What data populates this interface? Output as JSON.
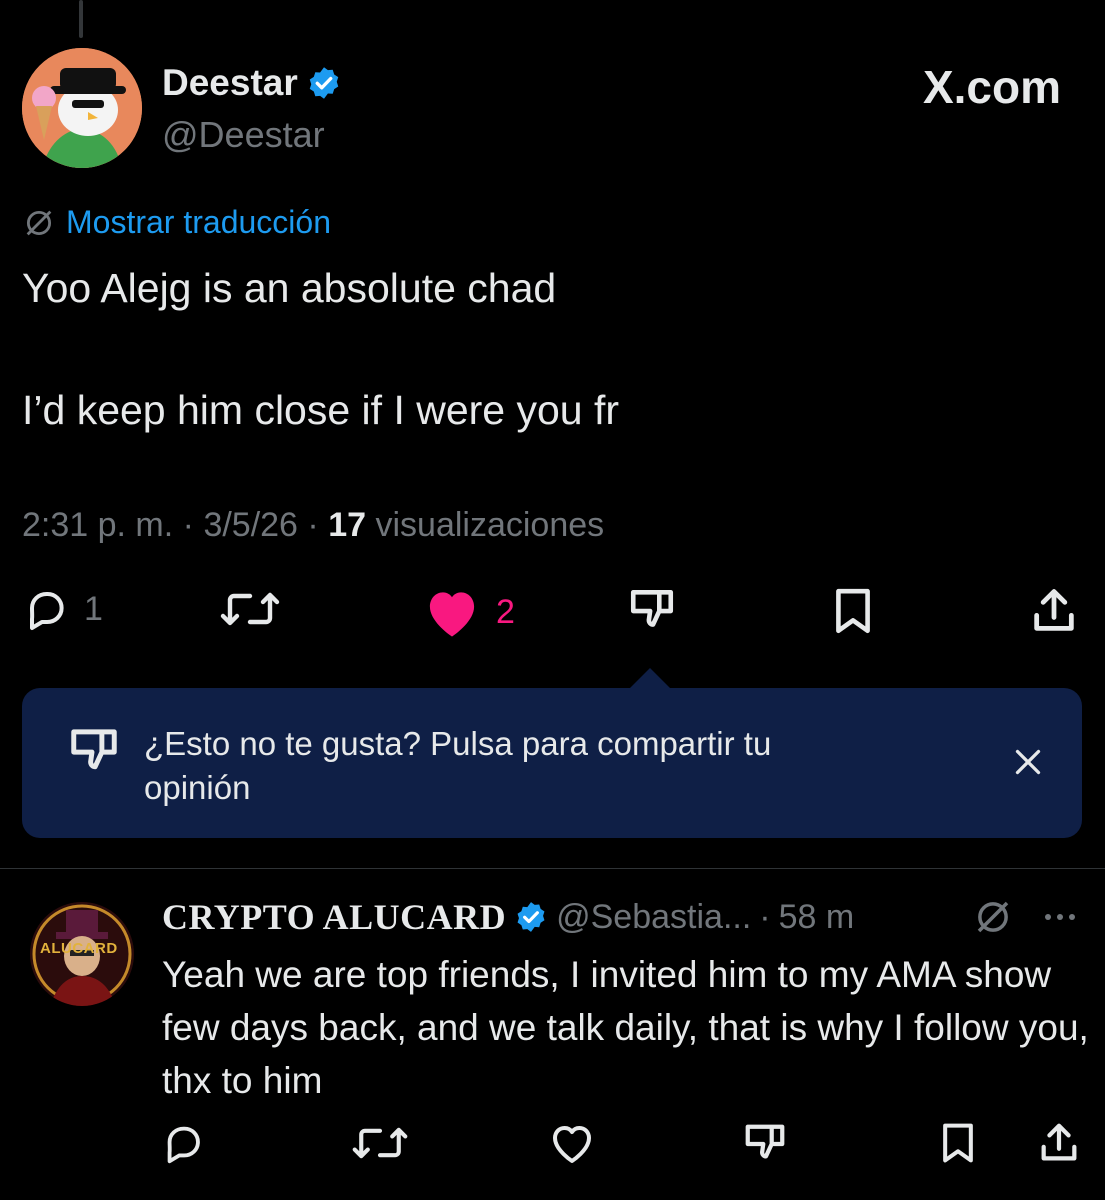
{
  "tweet": {
    "author_name": "Deestar",
    "author_handle": "@Deestar",
    "brand": "X.com",
    "translate_label": "Mostrar traducción",
    "line1": "Yoo Alejg is an absolute chad",
    "line2": "I’d keep him close if I were you fr",
    "time": "2:31 p. m.",
    "date": "3/5/26",
    "views_count": "17",
    "views_label": "visualizaciones",
    "replies": "1",
    "likes": "2"
  },
  "tooltip": {
    "text": "¿Esto no te gusta? Pulsa para compartir tu opinión"
  },
  "reply": {
    "author_name": "CRYPTO ALUCARD",
    "author_handle": "@Sebastia...",
    "age": "58 m",
    "avatar_text": "ALUCARD",
    "body": "Yeah we are top friends, I invited him to my AMA show few days back, and we talk daily, that is why I follow you, thx to him"
  },
  "colors": {
    "accent": "#1d9bf0",
    "like": "#f91880",
    "tooltip_bg": "#0f1f46",
    "muted": "#71767b"
  }
}
